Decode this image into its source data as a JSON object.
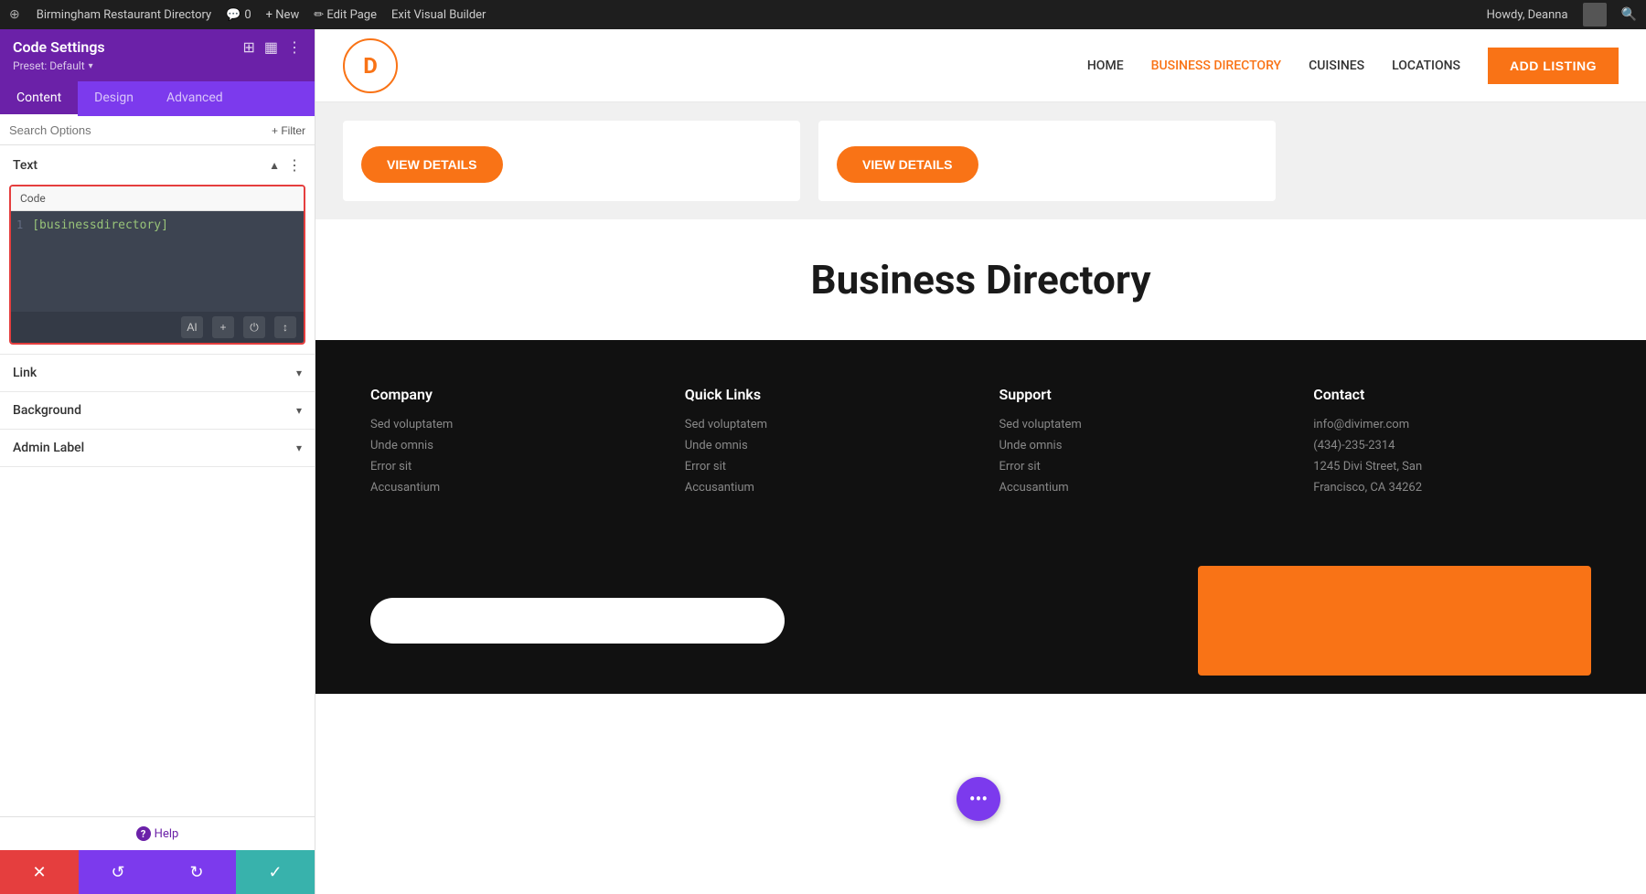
{
  "admin_bar": {
    "wp_logo": "⊕",
    "site_name": "Birmingham Restaurant Directory",
    "comments_icon": "💬",
    "comments_count": "0",
    "new_label": "+ New",
    "edit_page_label": "✏ Edit Page",
    "exit_vb_label": "Exit Visual Builder",
    "howdy_label": "Howdy, Deanna",
    "search_icon": "🔍"
  },
  "left_panel": {
    "title": "Code Settings",
    "preset_label": "Preset: Default",
    "preset_arrow": "▾",
    "icons": [
      "⊞",
      "▦",
      "⋮"
    ],
    "tabs": [
      "Content",
      "Design",
      "Advanced"
    ],
    "active_tab": "Content",
    "search_placeholder": "Search Options",
    "filter_label": "+ Filter"
  },
  "text_section": {
    "title": "Text",
    "dots": "⋮",
    "chevron": "▲",
    "code_label": "Code",
    "code_line_number": "1",
    "code_content": "[businessdirectory]",
    "toolbar_buttons": [
      "AI",
      "+",
      "⏻",
      "↕"
    ]
  },
  "link_section": {
    "title": "Link",
    "chevron": "▾"
  },
  "background_section": {
    "title": "Background",
    "chevron": "▾"
  },
  "admin_label_section": {
    "title": "Admin Label",
    "chevron": "▾"
  },
  "help": {
    "icon": "?",
    "label": "Help"
  },
  "actions": {
    "cancel_icon": "✕",
    "history_icon": "↺",
    "redo_icon": "↻",
    "save_icon": "✓"
  },
  "site_nav": {
    "logo_letter": "D",
    "links": [
      "HOME",
      "BUSINESS DIRECTORY",
      "CUISINES",
      "LOCATIONS"
    ],
    "active_link": "BUSINESS DIRECTORY",
    "add_listing": "ADD LISTING"
  },
  "cards": [
    {
      "btn_label": "VIEW DETAILS"
    },
    {
      "btn_label": "VIEW DETAILS"
    }
  ],
  "biz_dir": {
    "title": "Business Directory"
  },
  "footer": {
    "columns": [
      {
        "title": "Company",
        "links": [
          "Sed voluptatem",
          "Unde omnis",
          "Error sit",
          "Accusantium"
        ]
      },
      {
        "title": "Quick Links",
        "links": [
          "Sed voluptatem",
          "Unde omnis",
          "Error sit",
          "Accusantium"
        ]
      },
      {
        "title": "Support",
        "links": [
          "Sed voluptatem",
          "Unde omnis",
          "Error sit",
          "Accusantium"
        ]
      },
      {
        "title": "Contact",
        "links": [
          "info@divimer.com",
          "(434)-235-2314",
          "1245 Divi Street, San",
          "Francisco, CA 34262"
        ]
      }
    ]
  },
  "colors": {
    "purple": "#6b21a8",
    "orange": "#f97316",
    "teal": "#38b2ac",
    "red": "#e53e3e",
    "dark_purple": "#7c3aed"
  }
}
